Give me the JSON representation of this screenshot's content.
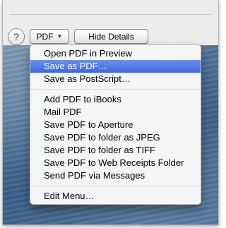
{
  "toolbar": {
    "help_label": "?",
    "pdf_label": "PDF",
    "pdf_arrow": "▼",
    "hide_details_label": "Hide Details"
  },
  "menu": {
    "group1": [
      "Open PDF in Preview",
      "Save as PDF…",
      "Save as PostScript…"
    ],
    "group2": [
      "Add PDF to iBooks",
      "Mail PDF",
      "Save PDF to Aperture",
      "Save PDF to folder as JPEG",
      "Save PDF to folder as TIFF",
      "Save PDF to Web Receipts Folder",
      "Send PDF via Messages"
    ],
    "group3": [
      "Edit Menu…"
    ],
    "selected": "Save as PDF…"
  },
  "colors": {
    "selection": "#3e66e0",
    "menu_bg": "#f8f8f8",
    "window_bg": "#ececec"
  }
}
